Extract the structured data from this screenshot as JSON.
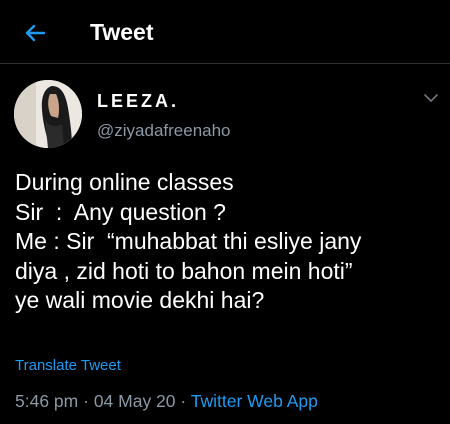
{
  "header": {
    "title": "Tweet",
    "back_icon": "arrow-left-icon"
  },
  "author": {
    "display_name": "LEEZA.",
    "handle": "@ziyadafreenaho"
  },
  "tweet": {
    "lines": [
      "During online classes",
      "Sir  :  Any question ?",
      "Me : Sir  “muhabbat thi esliye jany",
      "diya , zid hoti to bahon mein hoti”",
      "ye wali movie dekhi hai?"
    ],
    "translate_label": "Translate Tweet",
    "time": "5:46 pm",
    "date": "04 May 20",
    "separator": "·",
    "source": "Twitter Web App"
  },
  "colors": {
    "background": "#000000",
    "accent": "#1d9bf0",
    "secondary_text": "#8b98a5"
  }
}
